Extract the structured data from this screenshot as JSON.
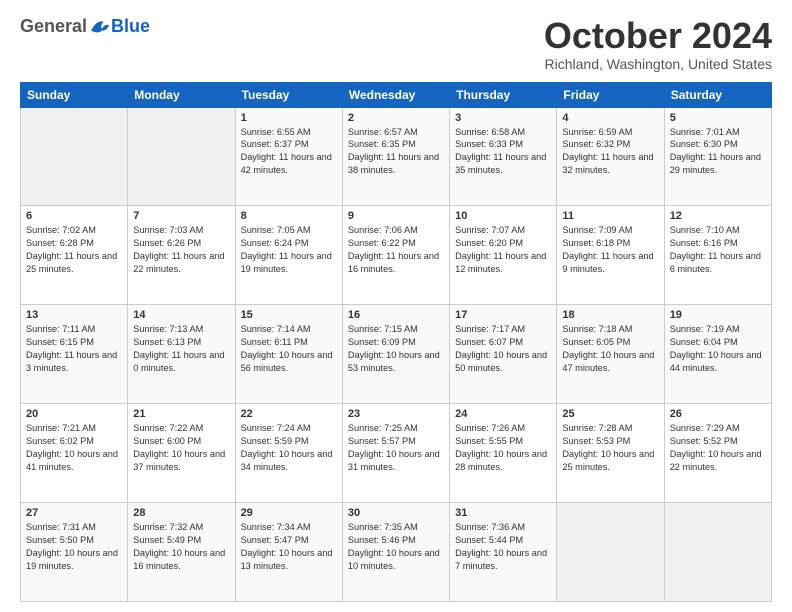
{
  "header": {
    "logo_general": "General",
    "logo_blue": "Blue",
    "title": "October 2024",
    "location": "Richland, Washington, United States"
  },
  "weekdays": [
    "Sunday",
    "Monday",
    "Tuesday",
    "Wednesday",
    "Thursday",
    "Friday",
    "Saturday"
  ],
  "weeks": [
    [
      {
        "day": "",
        "empty": true
      },
      {
        "day": "",
        "empty": true
      },
      {
        "day": "1",
        "sunrise": "Sunrise: 6:55 AM",
        "sunset": "Sunset: 6:37 PM",
        "daylight": "Daylight: 11 hours and 42 minutes."
      },
      {
        "day": "2",
        "sunrise": "Sunrise: 6:57 AM",
        "sunset": "Sunset: 6:35 PM",
        "daylight": "Daylight: 11 hours and 38 minutes."
      },
      {
        "day": "3",
        "sunrise": "Sunrise: 6:58 AM",
        "sunset": "Sunset: 6:33 PM",
        "daylight": "Daylight: 11 hours and 35 minutes."
      },
      {
        "day": "4",
        "sunrise": "Sunrise: 6:59 AM",
        "sunset": "Sunset: 6:32 PM",
        "daylight": "Daylight: 11 hours and 32 minutes."
      },
      {
        "day": "5",
        "sunrise": "Sunrise: 7:01 AM",
        "sunset": "Sunset: 6:30 PM",
        "daylight": "Daylight: 11 hours and 29 minutes."
      }
    ],
    [
      {
        "day": "6",
        "sunrise": "Sunrise: 7:02 AM",
        "sunset": "Sunset: 6:28 PM",
        "daylight": "Daylight: 11 hours and 25 minutes."
      },
      {
        "day": "7",
        "sunrise": "Sunrise: 7:03 AM",
        "sunset": "Sunset: 6:26 PM",
        "daylight": "Daylight: 11 hours and 22 minutes."
      },
      {
        "day": "8",
        "sunrise": "Sunrise: 7:05 AM",
        "sunset": "Sunset: 6:24 PM",
        "daylight": "Daylight: 11 hours and 19 minutes."
      },
      {
        "day": "9",
        "sunrise": "Sunrise: 7:06 AM",
        "sunset": "Sunset: 6:22 PM",
        "daylight": "Daylight: 11 hours and 16 minutes."
      },
      {
        "day": "10",
        "sunrise": "Sunrise: 7:07 AM",
        "sunset": "Sunset: 6:20 PM",
        "daylight": "Daylight: 11 hours and 12 minutes."
      },
      {
        "day": "11",
        "sunrise": "Sunrise: 7:09 AM",
        "sunset": "Sunset: 6:18 PM",
        "daylight": "Daylight: 11 hours and 9 minutes."
      },
      {
        "day": "12",
        "sunrise": "Sunrise: 7:10 AM",
        "sunset": "Sunset: 6:16 PM",
        "daylight": "Daylight: 11 hours and 6 minutes."
      }
    ],
    [
      {
        "day": "13",
        "sunrise": "Sunrise: 7:11 AM",
        "sunset": "Sunset: 6:15 PM",
        "daylight": "Daylight: 11 hours and 3 minutes."
      },
      {
        "day": "14",
        "sunrise": "Sunrise: 7:13 AM",
        "sunset": "Sunset: 6:13 PM",
        "daylight": "Daylight: 11 hours and 0 minutes."
      },
      {
        "day": "15",
        "sunrise": "Sunrise: 7:14 AM",
        "sunset": "Sunset: 6:11 PM",
        "daylight": "Daylight: 10 hours and 56 minutes."
      },
      {
        "day": "16",
        "sunrise": "Sunrise: 7:15 AM",
        "sunset": "Sunset: 6:09 PM",
        "daylight": "Daylight: 10 hours and 53 minutes."
      },
      {
        "day": "17",
        "sunrise": "Sunrise: 7:17 AM",
        "sunset": "Sunset: 6:07 PM",
        "daylight": "Daylight: 10 hours and 50 minutes."
      },
      {
        "day": "18",
        "sunrise": "Sunrise: 7:18 AM",
        "sunset": "Sunset: 6:05 PM",
        "daylight": "Daylight: 10 hours and 47 minutes."
      },
      {
        "day": "19",
        "sunrise": "Sunrise: 7:19 AM",
        "sunset": "Sunset: 6:04 PM",
        "daylight": "Daylight: 10 hours and 44 minutes."
      }
    ],
    [
      {
        "day": "20",
        "sunrise": "Sunrise: 7:21 AM",
        "sunset": "Sunset: 6:02 PM",
        "daylight": "Daylight: 10 hours and 41 minutes."
      },
      {
        "day": "21",
        "sunrise": "Sunrise: 7:22 AM",
        "sunset": "Sunset: 6:00 PM",
        "daylight": "Daylight: 10 hours and 37 minutes."
      },
      {
        "day": "22",
        "sunrise": "Sunrise: 7:24 AM",
        "sunset": "Sunset: 5:59 PM",
        "daylight": "Daylight: 10 hours and 34 minutes."
      },
      {
        "day": "23",
        "sunrise": "Sunrise: 7:25 AM",
        "sunset": "Sunset: 5:57 PM",
        "daylight": "Daylight: 10 hours and 31 minutes."
      },
      {
        "day": "24",
        "sunrise": "Sunrise: 7:26 AM",
        "sunset": "Sunset: 5:55 PM",
        "daylight": "Daylight: 10 hours and 28 minutes."
      },
      {
        "day": "25",
        "sunrise": "Sunrise: 7:28 AM",
        "sunset": "Sunset: 5:53 PM",
        "daylight": "Daylight: 10 hours and 25 minutes."
      },
      {
        "day": "26",
        "sunrise": "Sunrise: 7:29 AM",
        "sunset": "Sunset: 5:52 PM",
        "daylight": "Daylight: 10 hours and 22 minutes."
      }
    ],
    [
      {
        "day": "27",
        "sunrise": "Sunrise: 7:31 AM",
        "sunset": "Sunset: 5:50 PM",
        "daylight": "Daylight: 10 hours and 19 minutes."
      },
      {
        "day": "28",
        "sunrise": "Sunrise: 7:32 AM",
        "sunset": "Sunset: 5:49 PM",
        "daylight": "Daylight: 10 hours and 16 minutes."
      },
      {
        "day": "29",
        "sunrise": "Sunrise: 7:34 AM",
        "sunset": "Sunset: 5:47 PM",
        "daylight": "Daylight: 10 hours and 13 minutes."
      },
      {
        "day": "30",
        "sunrise": "Sunrise: 7:35 AM",
        "sunset": "Sunset: 5:46 PM",
        "daylight": "Daylight: 10 hours and 10 minutes."
      },
      {
        "day": "31",
        "sunrise": "Sunrise: 7:36 AM",
        "sunset": "Sunset: 5:44 PM",
        "daylight": "Daylight: 10 hours and 7 minutes."
      },
      {
        "day": "",
        "empty": true
      },
      {
        "day": "",
        "empty": true
      }
    ]
  ]
}
